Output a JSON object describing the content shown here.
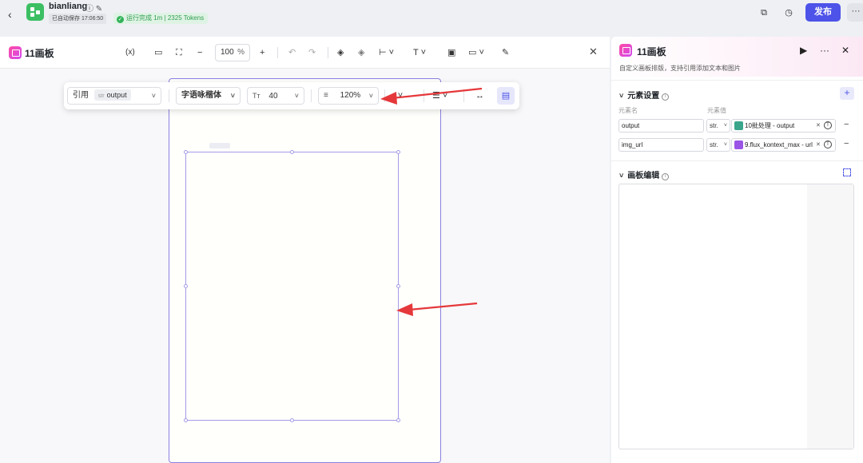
{
  "topbar": {
    "app_name": "bianliang",
    "autosave": "已自动保存 17:06:50",
    "run_status": "运行完成 1m | 2325 Tokens",
    "publish_label": "发布"
  },
  "editor": {
    "title": "11画板",
    "zoom_value": "100",
    "zoom_unit": "%",
    "variable_icon_label": "(x)"
  },
  "floating_toolbar": {
    "ref_label": "引用",
    "ref_type": "str",
    "ref_value": "output",
    "font_name": "字语咏楷体",
    "font_size": "40",
    "line_height": "120%"
  },
  "panel": {
    "title": "11画板",
    "description": "自定义画板排版，支持引用添加文本和图片",
    "element_settings": {
      "title": "元素设置",
      "col_name": "元素名",
      "col_value": "元素值",
      "rows": [
        {
          "name": "output",
          "type": "str.",
          "ref": "10批处理 - output",
          "ref_color": "#3aa58a"
        },
        {
          "name": "img_url",
          "type": "str.",
          "ref": "9.flux_kontext_max - url",
          "ref_color": "#9b55e6"
        }
      ]
    },
    "board_edit": {
      "title": "画板编辑"
    }
  },
  "colors": {
    "accent": "#4d53e8",
    "arrow": "#e5383b",
    "success": "#33b35a"
  }
}
